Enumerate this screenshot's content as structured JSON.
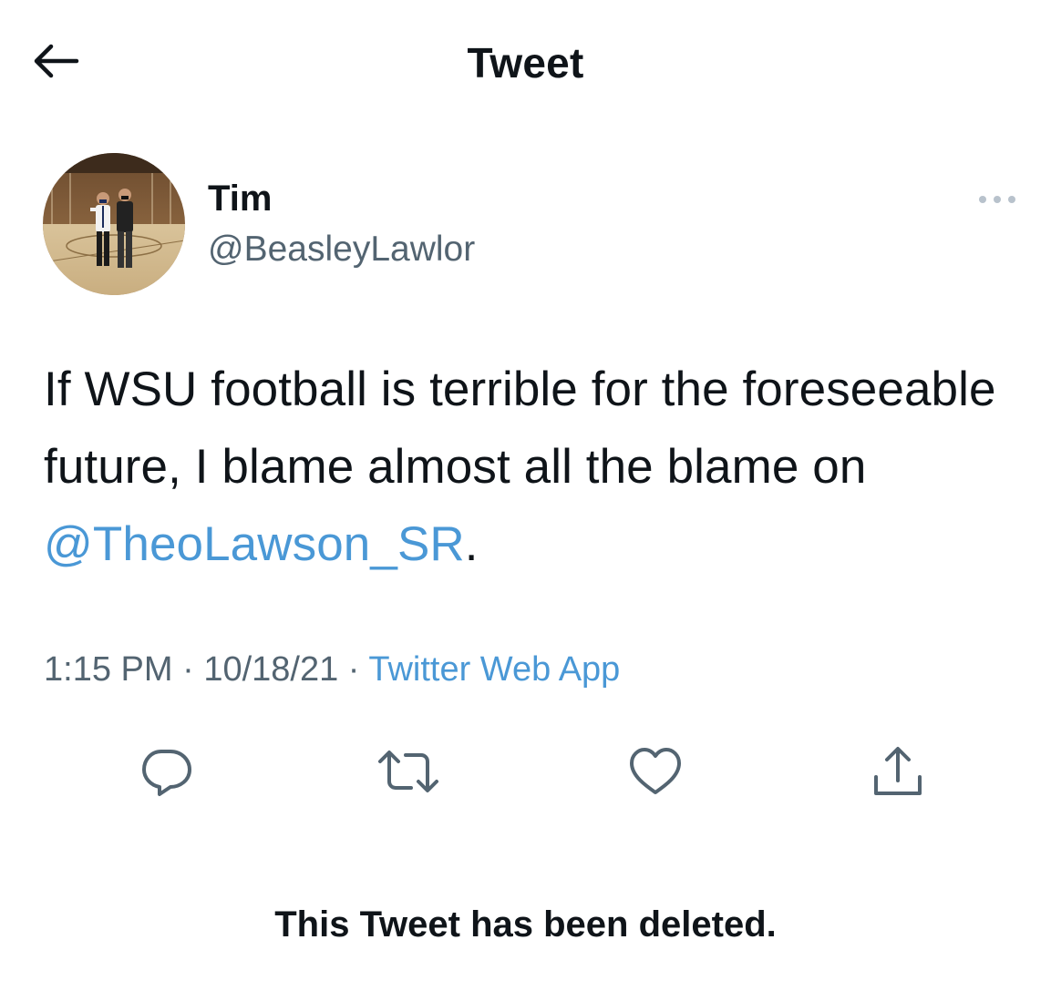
{
  "header": {
    "title": "Tweet",
    "back_icon": "arrow-left-icon"
  },
  "author": {
    "display_name": "Tim",
    "handle": "@BeasleyLawlor",
    "more_icon": "more-horizontal-icon"
  },
  "tweet": {
    "text_before": "If WSU football is terrible for the foreseeable future, I blame almost all the blame on ",
    "mention": "@TheoLawson_SR",
    "text_after": ".",
    "time": "1:15 PM",
    "separator": "·",
    "date": "10/18/21",
    "source": "Twitter Web App"
  },
  "actions": {
    "reply_icon": "reply-icon",
    "retweet_icon": "retweet-icon",
    "like_icon": "heart-icon",
    "share_icon": "share-icon"
  },
  "notice": "This Tweet has been deleted.",
  "colors": {
    "text": "#0f1419",
    "secondary": "#536471",
    "link": "#4a98d6",
    "icon": "#536471"
  }
}
